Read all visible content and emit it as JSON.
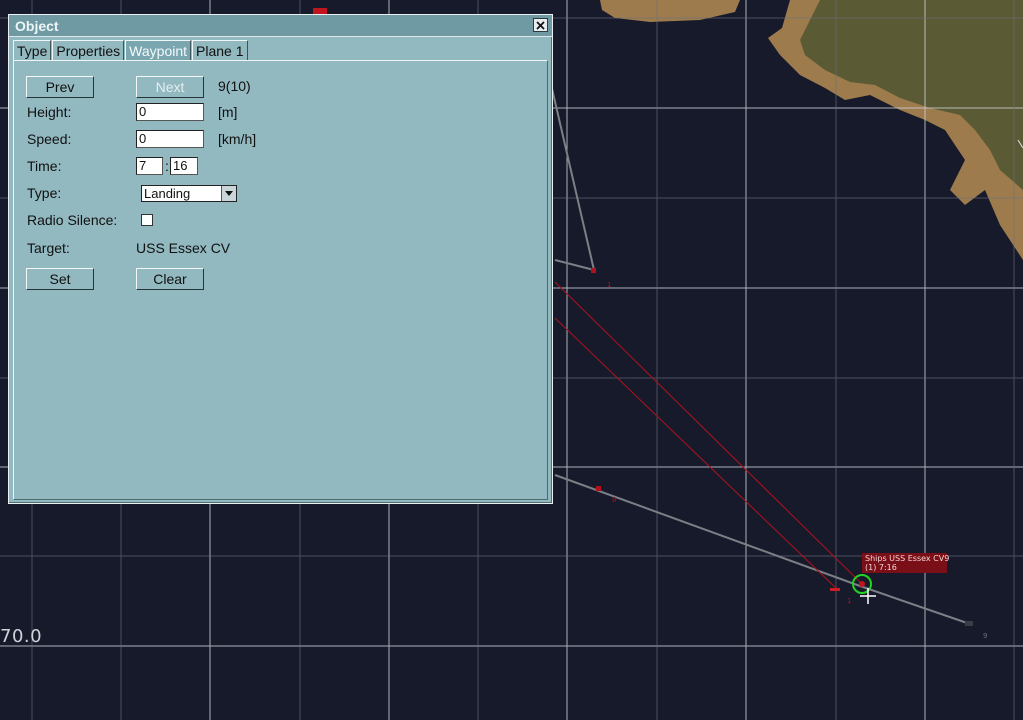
{
  "map": {
    "coord_label": "70.0",
    "ship_label_line1": "Ships USS Essex CV9",
    "ship_label_line2": "(1) 7:16",
    "waypoint_labels": [
      "1",
      "8",
      "1",
      "9"
    ]
  },
  "dialog": {
    "title": "Object",
    "tabs": [
      "Type",
      "Properties",
      "Waypoint",
      "Plane 1"
    ],
    "active_tab": "Waypoint",
    "prev_label": "Prev",
    "next_label": "Next",
    "waypoint_index": "9(10)",
    "height_label": "Height:",
    "height_value": "0",
    "height_unit": "[m]",
    "speed_label": "Speed:",
    "speed_value": "0",
    "speed_unit": "[km/h]",
    "time_label": "Time:",
    "time_hours": "7",
    "time_separator": ":",
    "time_minutes": "16",
    "type_label": "Type:",
    "type_value": "Landing",
    "radio_silence_label": "Radio Silence:",
    "target_label": "Target:",
    "target_value": "USS Essex CV",
    "set_label": "Set",
    "clear_label": "Clear"
  },
  "colors": {
    "ocean": "#161a2a",
    "land": "#9d7b4c",
    "dialog_bg": "#92b8c0",
    "route_red": "#b0121c",
    "route_gray": "#7c7f86",
    "selection_green": "#22d422"
  }
}
